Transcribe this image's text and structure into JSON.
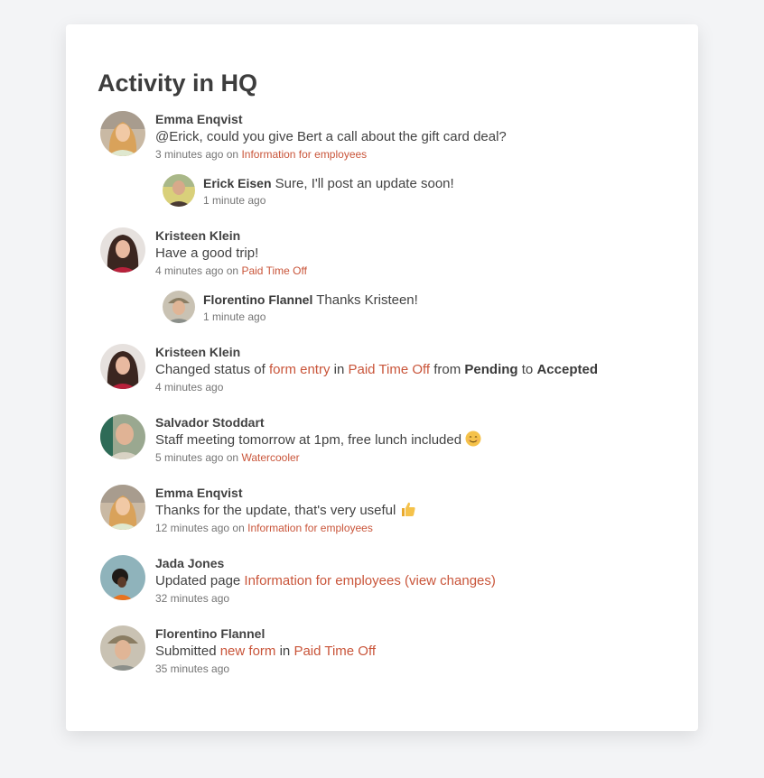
{
  "title": "Activity in HQ",
  "colors": {
    "accent": "#c9553a",
    "background": "#f3f4f6",
    "card": "#ffffff"
  },
  "activities": [
    {
      "author": "Emma Enqvist",
      "avatar": "avatar-emma",
      "message": "@Erick, could you give Bert a call about the gift card deal?",
      "time": "3 minutes ago",
      "on_label": "on",
      "location": "Information for employees",
      "reply": {
        "author": "Erick Eisen",
        "message": "Sure, I'll post an update soon!",
        "time": "1 minute ago"
      }
    },
    {
      "author": "Kristeen Klein",
      "avatar": "avatar-kristeen",
      "message": "Have a good trip!",
      "time": "4 minutes ago",
      "on_label": "on",
      "location": "Paid Time Off",
      "reply": {
        "author": "Florentino Flannel",
        "message": "Thanks Kristeen!",
        "time": "1 minute ago"
      }
    },
    {
      "author": "Kristeen Klein",
      "avatar": "avatar-kristeen",
      "parts": {
        "prefix": "Changed status of",
        "link1": "form entry",
        "in": "in",
        "link2": "Paid Time Off",
        "from": "from",
        "old_status": "Pending",
        "to": "to",
        "new_status": "Accepted"
      },
      "time": "4 minutes ago"
    },
    {
      "author": "Salvador Stoddart",
      "avatar": "avatar-salvador",
      "message": "Staff meeting tomorrow at 1pm, free lunch included",
      "emoji": "smiling-face-emoji",
      "time": "5 minutes ago",
      "on_label": "on",
      "location": "Watercooler"
    },
    {
      "author": "Emma Enqvist",
      "avatar": "avatar-emma",
      "message": "Thanks for the update, that's very useful",
      "emoji": "thumbs-up-emoji",
      "time": "12 minutes ago",
      "on_label": "on",
      "location": "Information for employees"
    },
    {
      "author": "Jada Jones",
      "avatar": "avatar-jada",
      "parts": {
        "prefix": "Updated page",
        "link1": "Information for employees (view changes)"
      },
      "time": "32 minutes ago"
    },
    {
      "author": "Florentino Flannel",
      "avatar": "avatar-florentino",
      "parts": {
        "prefix": "Submitted",
        "link1": "new form",
        "in": "in",
        "link2": "Paid Time Off"
      },
      "time": "35 minutes ago"
    }
  ]
}
